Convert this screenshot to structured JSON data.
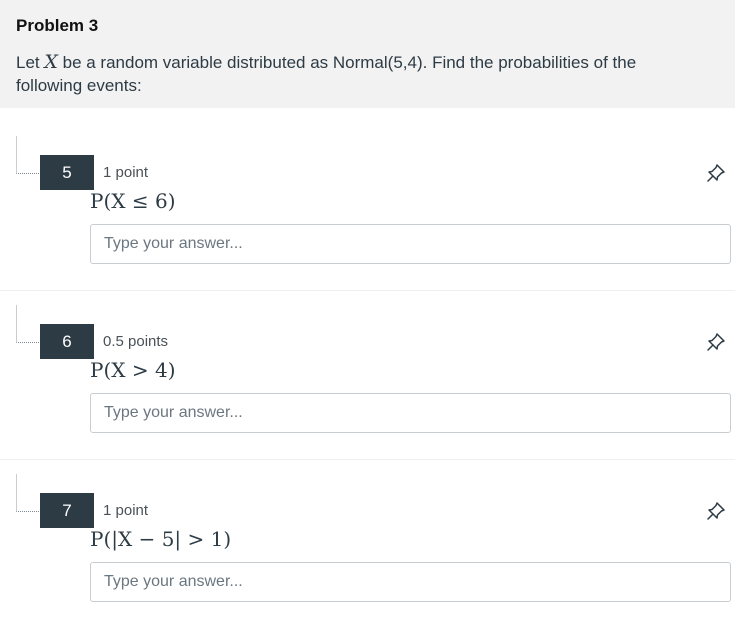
{
  "problem": {
    "title": "Problem 3",
    "desc_before": "Let ",
    "desc_var": "X",
    "desc_after": " be a random variable distributed as Normal(5,4). Find the probabilities of the following events:"
  },
  "questions": [
    {
      "number": "5",
      "points": "1 point",
      "expression": "P(X ≤ 6)",
      "answer_placeholder": "Type your answer...",
      "answer_value": ""
    },
    {
      "number": "6",
      "points": "0.5 points",
      "expression": "P(X > 4)",
      "answer_placeholder": "Type your answer...",
      "answer_value": ""
    },
    {
      "number": "7",
      "points": "1 point",
      "expression": "P(|X − 5| > 1)",
      "answer_placeholder": "Type your answer...",
      "answer_value": ""
    }
  ],
  "icons": {
    "pin": "pin-icon"
  },
  "colors": {
    "header_bg": "#f2f2f2",
    "number_badge_bg": "#2d3b45",
    "text": "#2d3b45"
  }
}
